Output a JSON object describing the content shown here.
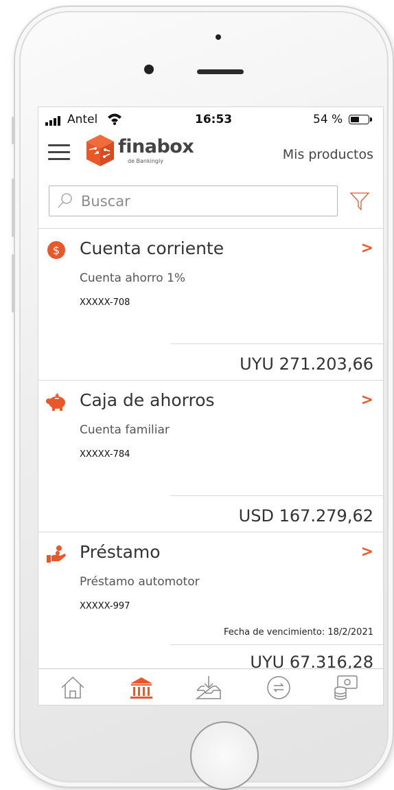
{
  "status_bar": {
    "carrier": "Antel",
    "time": "16:53",
    "battery": "54 %",
    "battery_level": 0.54
  },
  "header": {
    "logo_text": "finabox",
    "logo_subtext": "de Bankingly",
    "title": "Mis productos"
  },
  "search": {
    "placeholder": "Buscar"
  },
  "products": [
    {
      "icon": "dollar-coin-icon",
      "name": "Cuenta corriente",
      "description": "Cuenta ahorro 1%",
      "account": "XXXXX-708",
      "amount": "UYU 271.203,66"
    },
    {
      "icon": "piggy-bank-icon",
      "name": "Caja de ahorros",
      "description": "Cuenta familiar",
      "account": "XXXXX-784",
      "amount": "USD 167.279,62"
    },
    {
      "icon": "loan-hand-icon",
      "name": "Préstamo",
      "description": "Préstamo automotor",
      "account": "XXXXX-997",
      "due_date": "Fecha de vencimiento: 18/2/2021",
      "amount": "UYU 67.316,28"
    }
  ],
  "bottom_nav": [
    "home-icon",
    "bank-icon",
    "inbox-download-icon",
    "transfer-icon",
    "payments-icon"
  ],
  "colors": {
    "accent": "#e8582a",
    "text": "#333333"
  }
}
